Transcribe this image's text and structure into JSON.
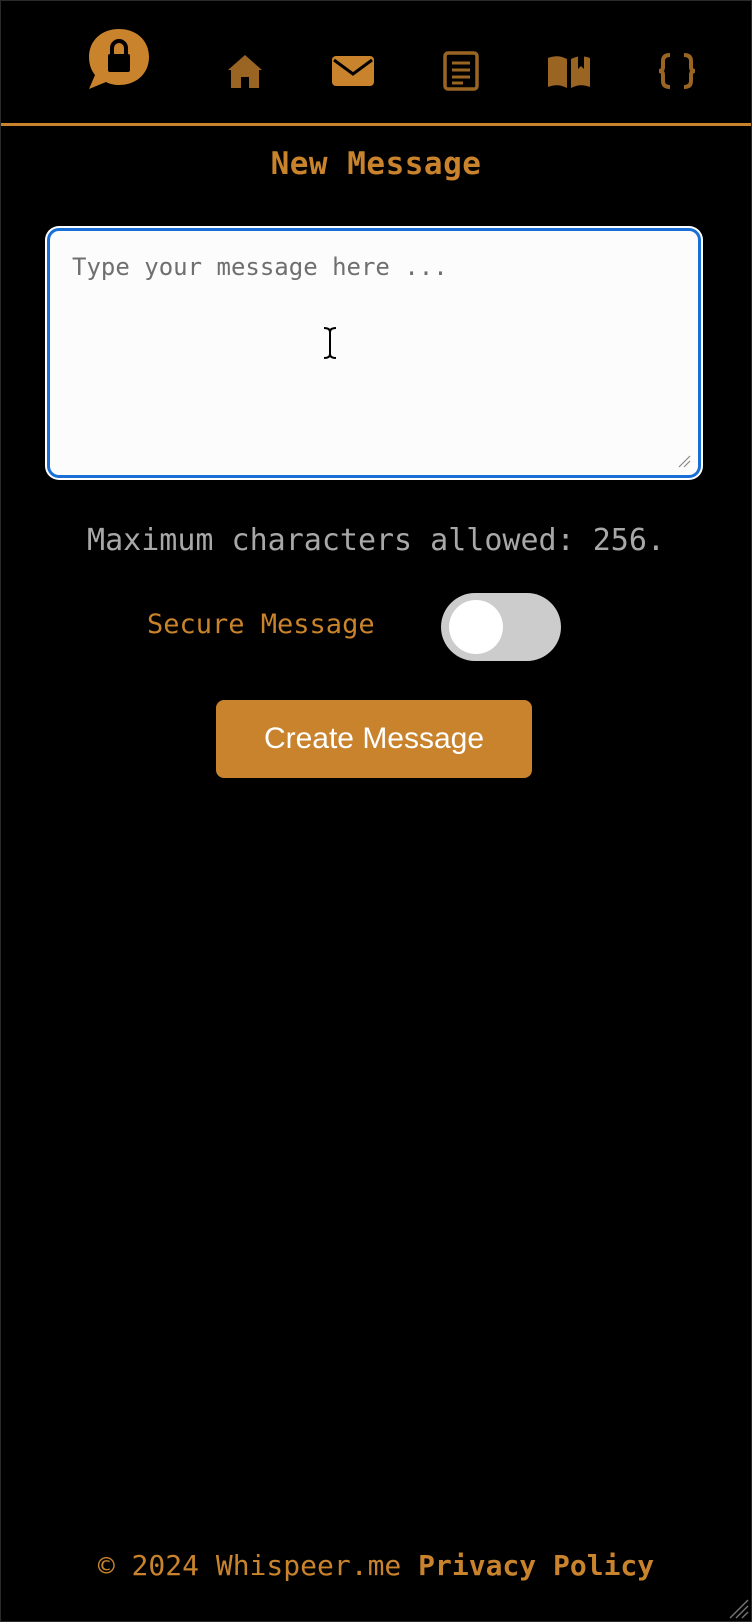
{
  "nav": {
    "logo_icon": "chat-bubble-lock-icon",
    "items": [
      {
        "icon": "home-icon"
      },
      {
        "icon": "envelope-icon"
      },
      {
        "icon": "document-icon"
      },
      {
        "icon": "book-open-icon"
      },
      {
        "icon": "curly-braces-icon"
      }
    ],
    "accent_color": "#c8832c"
  },
  "page": {
    "title": "New Message"
  },
  "form": {
    "message_placeholder": "Type your message here ...",
    "message_value": "",
    "char_limit_text": "Maximum characters allowed: 256.",
    "secure_label": "Secure Message",
    "secure_enabled": false,
    "submit_label": "Create Message"
  },
  "footer": {
    "copyright": "© 2024 Whispeer.me",
    "privacy_label": "Privacy Policy"
  },
  "colors": {
    "background": "#000000",
    "accent": "#c8832c",
    "muted_text": "#a8a8a8",
    "toggle_off": "#cccccc",
    "focus_ring": "#1a6fd6"
  }
}
